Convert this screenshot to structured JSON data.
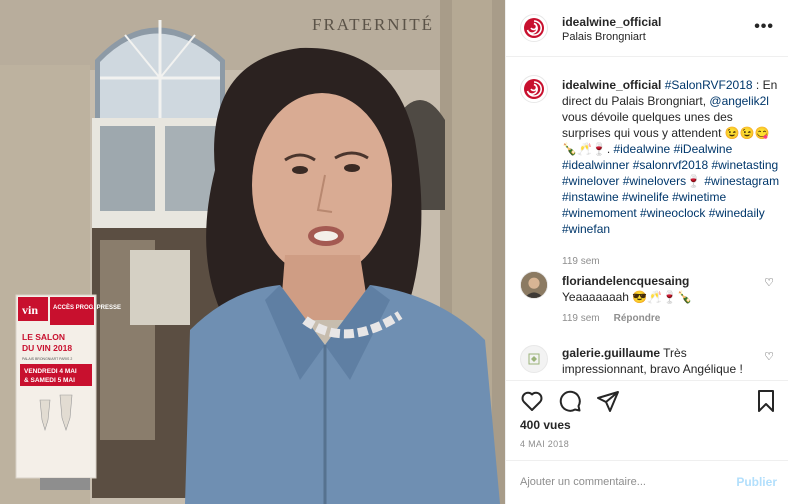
{
  "post": {
    "username": "idealwine_official",
    "location": "Palais Brongniart",
    "more_label": "•••"
  },
  "media": {
    "building_inscription": "FRATERNITÉ",
    "poster": {
      "logo": "vin",
      "banner": "ACCÈS PROG. PRESSE",
      "title_line1": "LE SALON",
      "title_line2": "DU VIN 2018",
      "venue": "PALAIS BRONGNIART PARIS 2",
      "date_line1": "VENDREDI 4 MAI",
      "date_line2": "& SAMEDI 5 MAI"
    }
  },
  "caption": {
    "username": "idealwine_official",
    "parts": [
      {
        "text": "#SalonRVF2018",
        "tag": true
      },
      {
        "text": " : En direct du Palais Brongniart, ",
        "tag": false
      },
      {
        "text": "@angelik2l",
        "tag": true
      },
      {
        "text": " vous dévoile quelques unes des surprises qui vous y attendent 😉😉😋🍾🥂🍷. ",
        "tag": false
      },
      {
        "text": "#idealwine",
        "tag": true
      },
      {
        "text": " ",
        "tag": false
      },
      {
        "text": "#iDealwine",
        "tag": true
      },
      {
        "text": " ",
        "tag": false
      },
      {
        "text": "#idealwinner",
        "tag": true
      },
      {
        "text": " ",
        "tag": false
      },
      {
        "text": "#salonrvf2018",
        "tag": true
      },
      {
        "text": " ",
        "tag": false
      },
      {
        "text": "#winetasting",
        "tag": true
      },
      {
        "text": " ",
        "tag": false
      },
      {
        "text": "#winelover",
        "tag": true
      },
      {
        "text": " ",
        "tag": false
      },
      {
        "text": "#winelovers",
        "tag": true
      },
      {
        "text": "🍷 ",
        "tag": false
      },
      {
        "text": "#winestagram",
        "tag": true
      },
      {
        "text": " ",
        "tag": false
      },
      {
        "text": "#instawine",
        "tag": true
      },
      {
        "text": " ",
        "tag": false
      },
      {
        "text": "#winelife",
        "tag": true
      },
      {
        "text": " ",
        "tag": false
      },
      {
        "text": "#winetime",
        "tag": true
      },
      {
        "text": " ",
        "tag": false
      },
      {
        "text": "#winemoment",
        "tag": true
      },
      {
        "text": " ",
        "tag": false
      },
      {
        "text": "#wineoclock",
        "tag": true
      },
      {
        "text": " ",
        "tag": false
      },
      {
        "text": "#winedaily",
        "tag": true
      },
      {
        "text": " ",
        "tag": false
      },
      {
        "text": "#winefan",
        "tag": true
      }
    ],
    "time": "119 sem"
  },
  "comments": [
    {
      "username": "floriandelencquesaing",
      "text": "Yeaaaaaaah 😎🥂🍷🍾",
      "time": "119 sem",
      "reply_label": "Répondre"
    },
    {
      "username": "galerie.guillaume",
      "text": "Très impressionnant, bravo Angélique !"
    }
  ],
  "actions": {
    "views": "400 vues",
    "date": "4 MAI 2018"
  },
  "add_comment": {
    "placeholder": "Ajouter un commentaire...",
    "publish_label": "Publier"
  },
  "colors": {
    "link": "#00376b",
    "muted": "#8e8e8e",
    "publish_disabled": "#b2dffc",
    "brand_red": "#c8102e"
  }
}
